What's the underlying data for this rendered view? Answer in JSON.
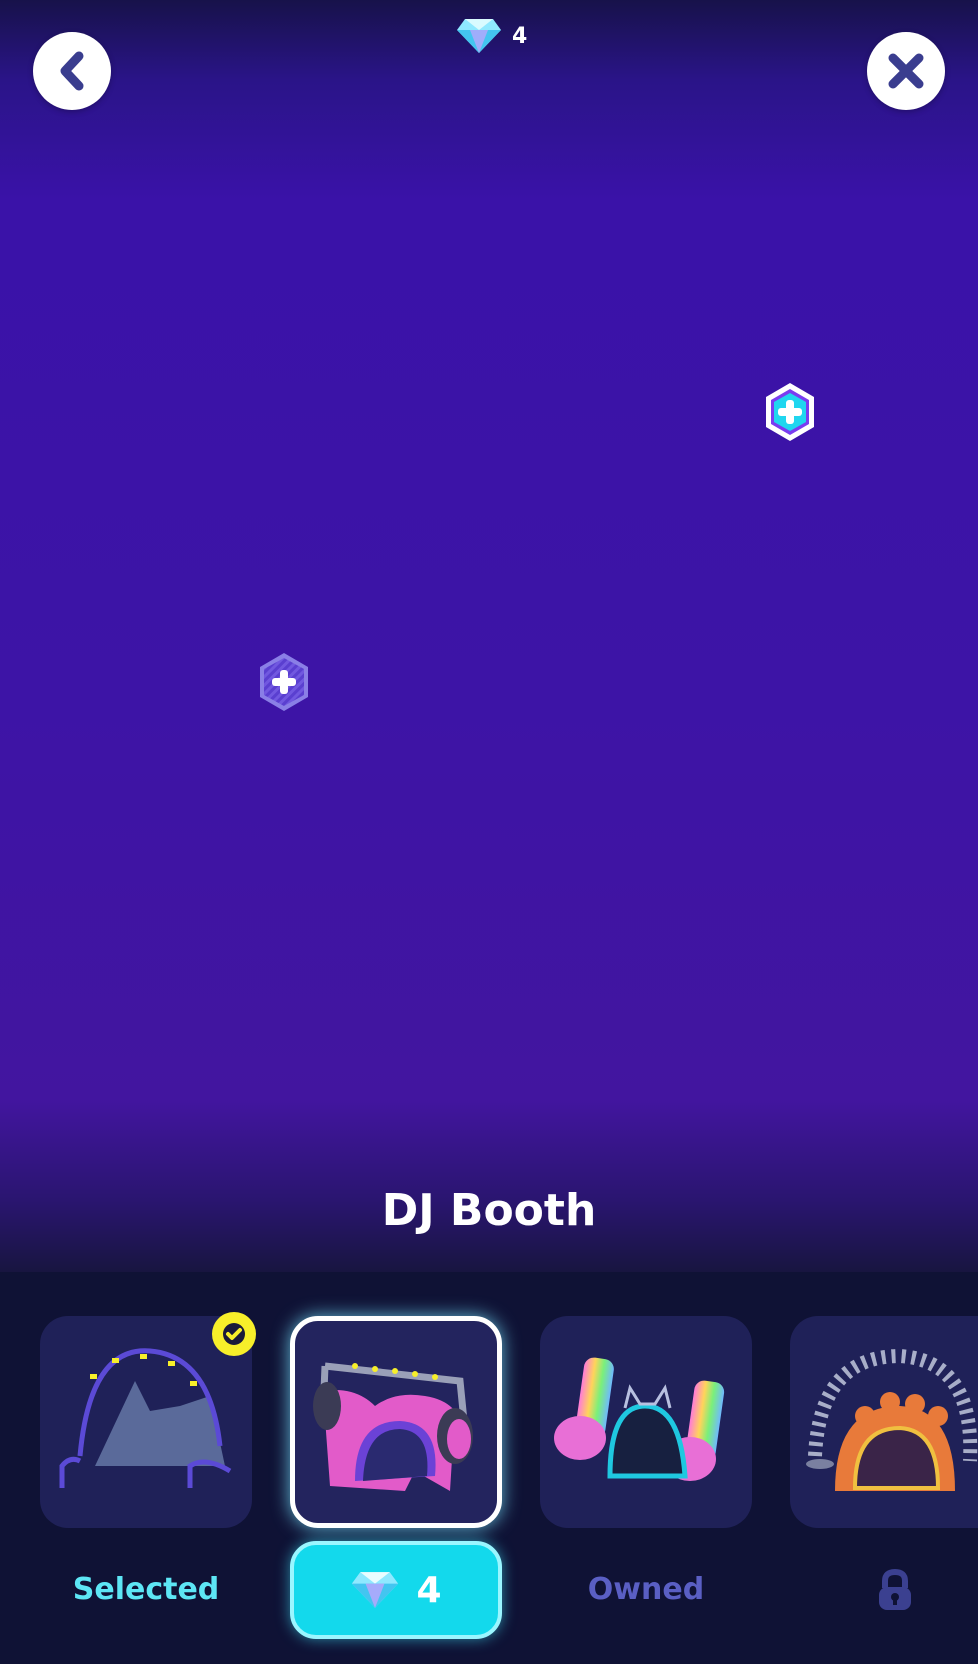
{
  "header": {
    "gem_count": "4"
  },
  "item_title": "DJ Booth",
  "icons": {
    "back": "chevron-left-icon",
    "close": "close-icon",
    "currency": "gem-icon",
    "status_selected": "check-icon",
    "locked": "lock-icon",
    "hotspot": "plus-icon"
  },
  "colors": {
    "stage": "#3d14a6",
    "tray": "#0f1235",
    "card": "#1f2158",
    "accent_cyan": "#13d9ec",
    "selected_badge": "#f7ef2a"
  },
  "items": [
    {
      "name": "Neon Arch Stage",
      "status": "selected",
      "label": "Selected"
    },
    {
      "name": "DJ Booth",
      "status": "for_sale",
      "price": "4",
      "highlighted": true
    },
    {
      "name": "Rainbow Notes Stage",
      "status": "owned",
      "label": "Owned"
    },
    {
      "name": "Paw Arch Stage",
      "status": "locked"
    }
  ]
}
